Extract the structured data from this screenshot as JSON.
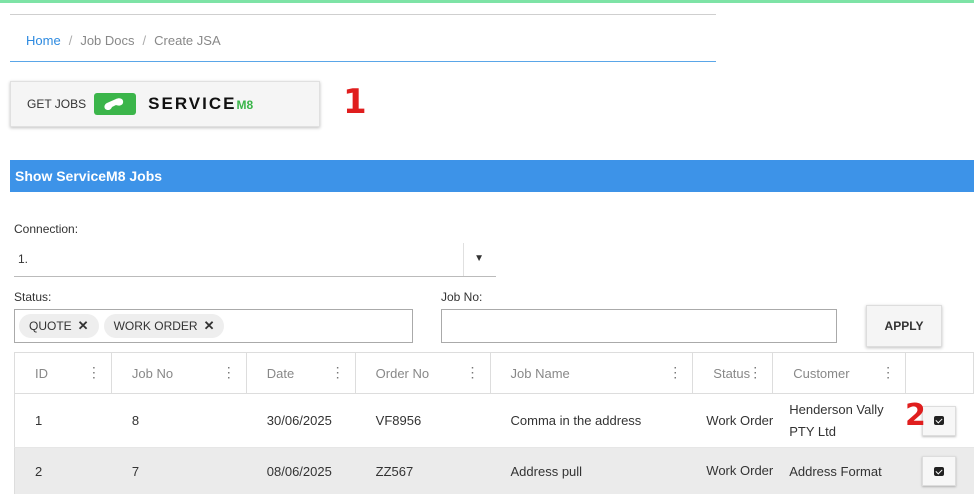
{
  "breadcrumb": {
    "home": "Home",
    "job_docs": "Job Docs",
    "current": "Create JSA",
    "separator": "/"
  },
  "get_jobs": {
    "label": "GET JOBS",
    "brand_word": "SERVICE",
    "brand_suffix": "M8"
  },
  "annotations": {
    "one": "1",
    "two": "2"
  },
  "section": {
    "title": "Show ServiceM8 Jobs"
  },
  "filters": {
    "connection_label": "Connection:",
    "connection_value": "1.",
    "status_label": "Status:",
    "status_chips": [
      "QUOTE",
      "WORK ORDER"
    ],
    "jobno_label": "Job No:",
    "jobno_value": "",
    "apply_label": "APPLY"
  },
  "table": {
    "columns": [
      "ID",
      "Job No",
      "Date",
      "Order No",
      "Job Name",
      "Status",
      "Customer"
    ],
    "rows": [
      {
        "id": "1",
        "job_no": "8",
        "date": "30/06/2025",
        "order_no": "VF8956",
        "job_name": "Comma in the address",
        "status": "Work Order",
        "customer": "Henderson Vally PTY Ltd"
      },
      {
        "id": "2",
        "job_no": "7",
        "date": "08/06/2025",
        "order_no": "ZZ567",
        "job_name": "Address pull",
        "status": "Work Order",
        "customer": "Address Format"
      }
    ]
  },
  "colors": {
    "accent": "#3d93e8",
    "link": "#2d8ae0",
    "annotation": "#e01e1e",
    "brand_green": "#3bb54a"
  }
}
